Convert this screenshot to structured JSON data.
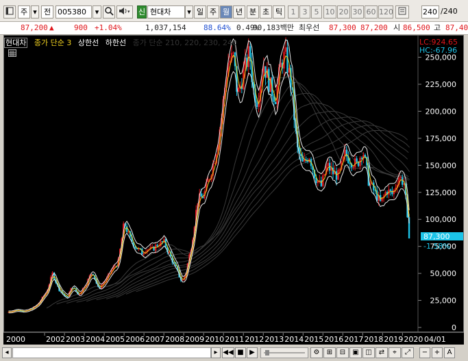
{
  "toolbar": {
    "period": "주",
    "market": "전",
    "code": "005380",
    "name_badge": "신",
    "name": "현대차",
    "tabs": [
      "일",
      "주",
      "월",
      "년",
      "분",
      "초",
      "틱"
    ],
    "selected_tab": "월",
    "intervals": [
      "1",
      "3",
      "5",
      "10",
      "20",
      "30",
      "60",
      "120"
    ],
    "count_value": "240",
    "count_total": "/240"
  },
  "quote": {
    "price": "87,200",
    "change": "900",
    "change_pct": "+1.04%",
    "volume": "1,037,154",
    "ratio1": "88.64%",
    "ratio2": "0.49%",
    "amount": "90,183백만",
    "best_label": "최우선",
    "best_ask": "87,300",
    "best_bid": "87,200",
    "open_label": "시",
    "open": "86,500",
    "high_label": "고",
    "high": "87,40"
  },
  "legend": {
    "name": "현대차",
    "ma": "종가 단순 3",
    "upper": "상한선",
    "lower": "하한선",
    "faded": "종가 단순 210, 220, 230, 240"
  },
  "info": {
    "lc": "LC:924.65",
    "hc": "HC:-67.96",
    "last_price": "87,300",
    "last_pct": "-1.58%"
  },
  "colors": {
    "up": "#e0161b",
    "down": "#1cc4e8",
    "price_line": "#ffffff",
    "ma": "#f0d020",
    "band": "#a0a0a0"
  },
  "icons": [
    "grid-icon",
    "magnifier-icon",
    "speaker-icon",
    "dropdown-icon",
    "first-icon",
    "prev-icon",
    "stop-icon",
    "next-icon",
    "last-icon",
    "zoom-out-icon",
    "zoom-in-icon",
    "auto-icon"
  ],
  "chart_data": {
    "type": "line",
    "title": "",
    "xlabel": "",
    "ylabel": "",
    "ylim": [
      0,
      270000
    ],
    "y_ticks": [
      "0",
      "25,000",
      "50,000",
      "75,000",
      "100,000",
      "125,000",
      "150,000",
      "175,000",
      "200,000",
      "225,000",
      "250,000"
    ],
    "x_ticks": [
      "2000",
      "2002",
      "2003",
      "2004",
      "2005",
      "2006",
      "2007",
      "2008",
      "2009",
      "2010",
      "2011",
      "2012",
      "2013",
      "2014",
      "2015",
      "2016",
      "2017",
      "2018",
      "2019",
      "2020",
      "04/01"
    ],
    "x": [
      2000.0,
      2000.5,
      2001.0,
      2001.5,
      2002.0,
      2002.3,
      2002.6,
      2003.0,
      2003.3,
      2003.6,
      2004.0,
      2004.3,
      2004.6,
      2005.0,
      2005.3,
      2005.6,
      2005.9,
      2006.2,
      2006.5,
      2006.8,
      2007.0,
      2007.3,
      2007.6,
      2007.9,
      2008.2,
      2008.5,
      2008.8,
      2009.0,
      2009.3,
      2009.6,
      2009.9,
      2010.2,
      2010.5,
      2010.8,
      2011.1,
      2011.4,
      2011.6,
      2011.9,
      2012.2,
      2012.4,
      2012.6,
      2012.9,
      2013.2,
      2013.5,
      2013.8,
      2014.0,
      2014.3,
      2014.6,
      2014.9,
      2015.2,
      2015.5,
      2015.8,
      2016.1,
      2016.4,
      2016.7,
      2017.0,
      2017.3,
      2017.6,
      2017.9,
      2018.2,
      2018.5,
      2018.8,
      2019.1,
      2019.4,
      2019.7,
      2020.0,
      2020.2,
      2020.3
    ],
    "series": [
      {
        "values": [
          14000,
          16000,
          15000,
          20000,
          33000,
          50000,
          36000,
          27000,
          38000,
          30000,
          41000,
          52000,
          36000,
          44000,
          54000,
          60000,
          97000,
          82000,
          74000,
          69000,
          73000,
          72000,
          77000,
          79000,
          67000,
          55000,
          42000,
          50000,
          78000,
          118000,
          122000,
          140000,
          160000,
          195000,
          245000,
          250000,
          215000,
          235000,
          255000,
          220000,
          210000,
          245000,
          225000,
          212000,
          245000,
          252000,
          225000,
          165000,
          150000,
          160000,
          140000,
          130000,
          150000,
          143000,
          140000,
          160000,
          155000,
          150000,
          165000,
          135000,
          125000,
          115000,
          127000,
          123000,
          140000,
          133000,
          85000,
          87300
        ]
      }
    ],
    "grid": false,
    "legend_position": "top-left"
  }
}
